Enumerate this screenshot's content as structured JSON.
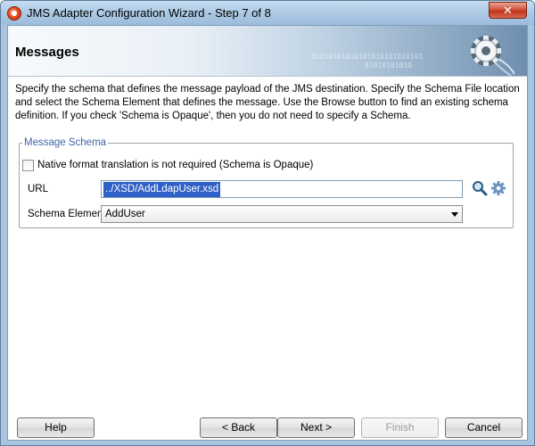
{
  "window": {
    "title": "JMS Adapter Configuration Wizard - Step 7 of 8",
    "close_label": "✕"
  },
  "header": {
    "title": "Messages",
    "binary_line1": "01010101010101010101010101",
    "binary_line2": "01010101010"
  },
  "description": "Specify the schema that defines the message payload of the JMS destination.  Specify the Schema File location and select the Schema Element that defines the message. Use the Browse button to find an existing schema definition. If you check 'Schema is Opaque', then you do not need to specify a Schema.",
  "schema_group": {
    "legend": "Message Schema",
    "opaque_checkbox": {
      "label": "Native format translation is not required (Schema is Opaque)",
      "checked": false
    },
    "url": {
      "label": "URL",
      "value": "../XSD/AddLdapUser.xsd"
    },
    "schema_element": {
      "label": "Schema Element",
      "selected": "AddUser"
    }
  },
  "buttons": {
    "help": "Help",
    "back": "< Back",
    "next": "Next >",
    "finish": "Finish",
    "cancel": "Cancel"
  },
  "icons": {
    "search": "search-icon",
    "browse": "gear-icon",
    "app": "app-icon"
  }
}
